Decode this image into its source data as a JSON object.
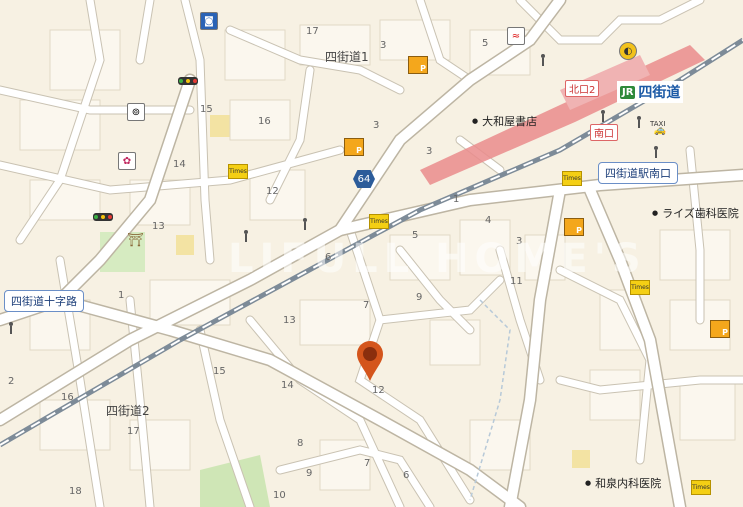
{
  "map": {
    "areas": [
      {
        "id": "yotsukaido-1",
        "text": "四街道1"
      },
      {
        "id": "yotsukaido-2",
        "text": "四街道2"
      }
    ],
    "block_numbers": [
      "17",
      "3",
      "5",
      "15",
      "16",
      "14",
      "12",
      "13",
      "1",
      "2",
      "64",
      "3",
      "1",
      "4",
      "5",
      "3",
      "6",
      "7",
      "9",
      "11",
      "13",
      "14",
      "15",
      "8",
      "12",
      "17",
      "16",
      "18",
      "7",
      "10",
      "9",
      "6"
    ],
    "route_shield": "64",
    "station": {
      "jr_mark": "JR",
      "name": "四街道",
      "north_exit": "北口2",
      "south_exit": "南口"
    },
    "callouts": {
      "station_south": "四街道駅南口",
      "crossing": "四街道十字路"
    },
    "pois": [
      {
        "id": "yamatoya",
        "text": "大和屋書店"
      },
      {
        "id": "rise-dental",
        "text": "ライズ歯科医院"
      },
      {
        "id": "izumi-clinic",
        "text": "和泉内科医院"
      }
    ],
    "icons": {
      "times": "Times",
      "taxi": "TAXI",
      "shrine": "⛩"
    },
    "colors": {
      "background": "#f7f1e3",
      "road": "#ffffff",
      "road_edge": "#c9c2b2",
      "rail": "#7d8b98",
      "station_platform": "#ea8c8c",
      "park": "#cfe6b6",
      "pin": "#d4551c"
    },
    "watermark": "LIFULL HOME'S"
  }
}
